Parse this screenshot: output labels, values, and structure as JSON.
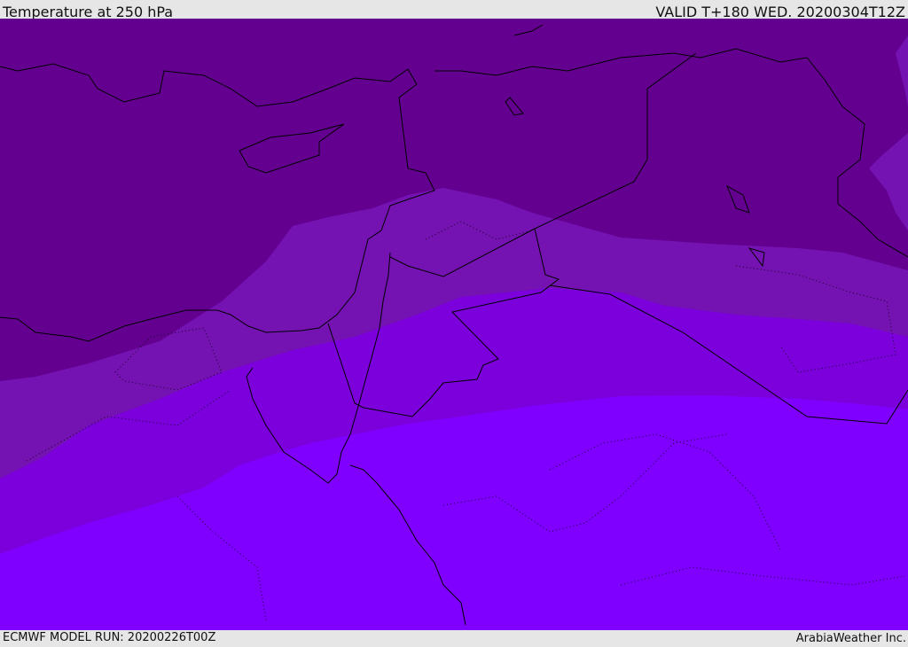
{
  "header": {
    "title": "Temperature at 250 hPa",
    "valid": "VALID T+180 WED. 20200304T12Z"
  },
  "footer": {
    "model_run": "ECMWF MODEL RUN: 20200226T00Z",
    "credit": "ArabiaWeather Inc."
  },
  "colors": {
    "band_coldest": "#640090",
    "band_2": "#7412b2",
    "band_3": "#7b00dc",
    "band_warmest": "#7f00ff"
  }
}
